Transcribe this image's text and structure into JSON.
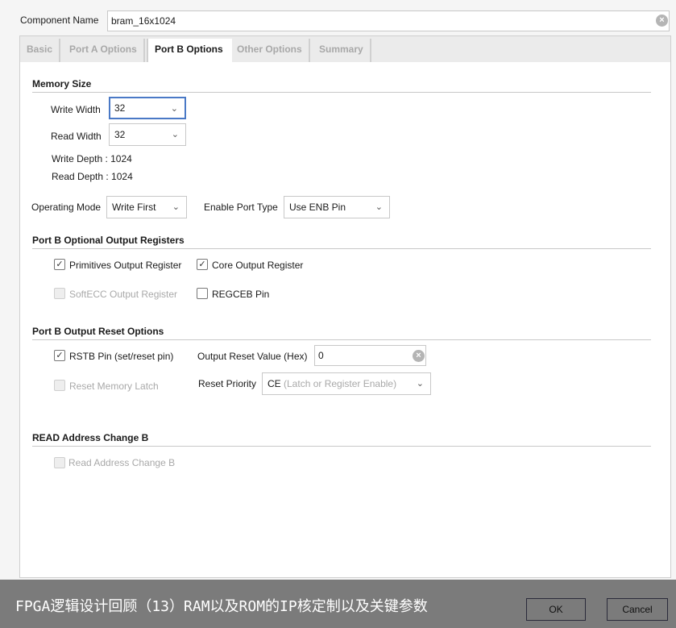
{
  "component_name": {
    "label": "Component Name",
    "value": "bram_16x1024"
  },
  "tabs": [
    {
      "label": "Basic"
    },
    {
      "label": "Port A Options"
    },
    {
      "label": "Port B Options"
    },
    {
      "label": "Other Options"
    },
    {
      "label": "Summary"
    }
  ],
  "active_tab": "Port B Options",
  "memory_size": {
    "title": "Memory Size",
    "write_width_label": "Write Width",
    "write_width": "32",
    "read_width_label": "Read Width",
    "read_width": "32",
    "write_depth": "Write Depth : 1024",
    "read_depth": "Read Depth : 1024"
  },
  "operating_mode": {
    "label": "Operating Mode",
    "value": "Write First"
  },
  "enable_port_type": {
    "label": "Enable Port Type",
    "value": "Use ENB Pin"
  },
  "output_registers": {
    "title": "Port B Optional Output Registers",
    "primitives": {
      "label": "Primitives Output Register",
      "checked": true
    },
    "core": {
      "label": "Core Output Register",
      "checked": true
    },
    "softecc": {
      "label": "SoftECC Output Register",
      "checked": false,
      "disabled": true
    },
    "regceb": {
      "label": "REGCEB Pin",
      "checked": false
    }
  },
  "reset_options": {
    "title": "Port B Output Reset Options",
    "rstb": {
      "label": "RSTB Pin (set/reset pin)",
      "checked": true
    },
    "reset_value_label": "Output Reset Value (Hex)",
    "reset_value": "0",
    "reset_latch": {
      "label": "Reset Memory Latch",
      "checked": false,
      "disabled": true
    },
    "priority_label": "Reset Priority",
    "priority_value": "CE",
    "priority_hint": "(Latch or Register Enable)"
  },
  "read_addr": {
    "title": "READ Address Change B",
    "checkbox": {
      "label": "Read Address Change B",
      "checked": false,
      "disabled": true
    }
  },
  "footer": {
    "caption": "FPGA逻辑设计回顾（13）RAM以及ROM的IP核定制以及关键参数",
    "ok": "OK",
    "cancel": "Cancel"
  },
  "colors": {
    "focus": "#4a79c6",
    "overlay": "#7b7b7b"
  }
}
